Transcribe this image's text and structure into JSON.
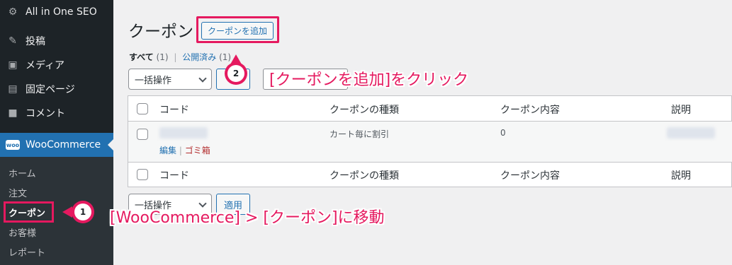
{
  "sidebar": {
    "items": [
      {
        "label": "All in One SEO",
        "icon": "gear-icon"
      },
      {
        "label": "投稿",
        "icon": "pin-icon"
      },
      {
        "label": "メディア",
        "icon": "media-icon"
      },
      {
        "label": "固定ページ",
        "icon": "page-icon"
      },
      {
        "label": "コメント",
        "icon": "comment-icon"
      },
      {
        "label": "WooCommerce",
        "icon": "woo-icon",
        "logo_text": "woo"
      }
    ],
    "submenu": [
      "ホーム",
      "注文",
      "クーポン",
      "お客様",
      "レポート"
    ]
  },
  "main": {
    "title": "クーポン",
    "add_button": "クーポンを追加",
    "filters": {
      "all_label": "すべて",
      "all_count": "(1)",
      "separator": "|",
      "published_label": "公開済み",
      "published_count": "(1)"
    },
    "bulk_action": "一括操作",
    "apply_label": "適用",
    "table": {
      "columns": [
        "コード",
        "クーポンの種類",
        "クーポン内容",
        "説明"
      ],
      "row": {
        "type": "カート毎に割引",
        "amount": "0",
        "edit": "編集",
        "separator": "|",
        "trash": "ゴミ箱"
      }
    }
  },
  "annotations": {
    "step1_number": "1",
    "step1_text": "[WooCommerce] > [クーポン]に移動",
    "step2_number": "2",
    "step2_text": "[クーポンを追加]をクリック",
    "color": "#e5195f"
  }
}
